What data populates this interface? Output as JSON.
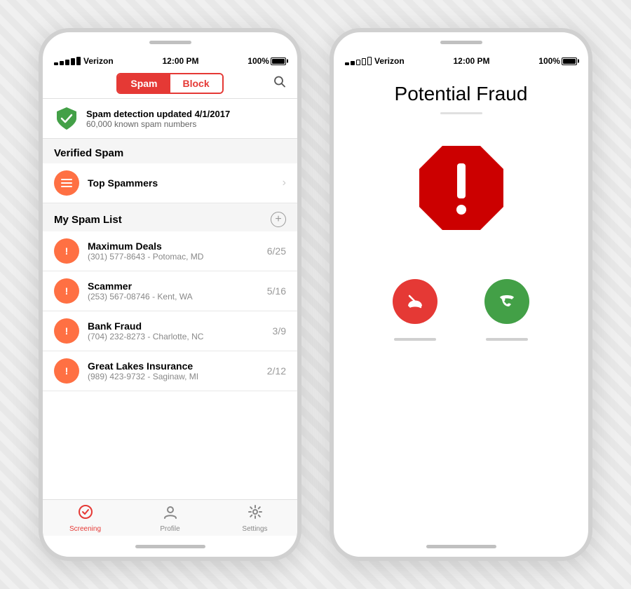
{
  "phones": {
    "left": {
      "statusBar": {
        "carrier": "Verizon",
        "time": "12:00 PM",
        "battery": "100%"
      },
      "segmented": {
        "spam": "Spam",
        "block": "Block"
      },
      "updateNotice": {
        "title": "Spam detection updated 4/1/2017",
        "subtitle": "60,000 known spam numbers"
      },
      "verifiedSpamLabel": "Verified Spam",
      "topSpammersLabel": "Top Spammers",
      "mySpamListLabel": "My Spam List",
      "spamItems": [
        {
          "name": "Maximum Deals",
          "detail": "(301) 577-8643 - Potomac, MD",
          "count": "6/25"
        },
        {
          "name": "Scammer",
          "detail": "(253) 567-08746 - Kent, WA",
          "count": "5/16"
        },
        {
          "name": "Bank Fraud",
          "detail": "(704) 232-8273 - Charlotte, NC",
          "count": "3/9"
        },
        {
          "name": "Great Lakes Insurance",
          "detail": "(989) 423-9732 - Saginaw, MI",
          "count": "2/12"
        }
      ],
      "tabs": [
        {
          "label": "Screening",
          "active": true
        },
        {
          "label": "Profile",
          "active": false
        },
        {
          "label": "Settings",
          "active": false
        }
      ]
    },
    "right": {
      "statusBar": {
        "carrier": "Verizon",
        "time": "12:00 PM",
        "battery": "100%"
      },
      "fraudTitle": "Potential Fraud"
    }
  }
}
